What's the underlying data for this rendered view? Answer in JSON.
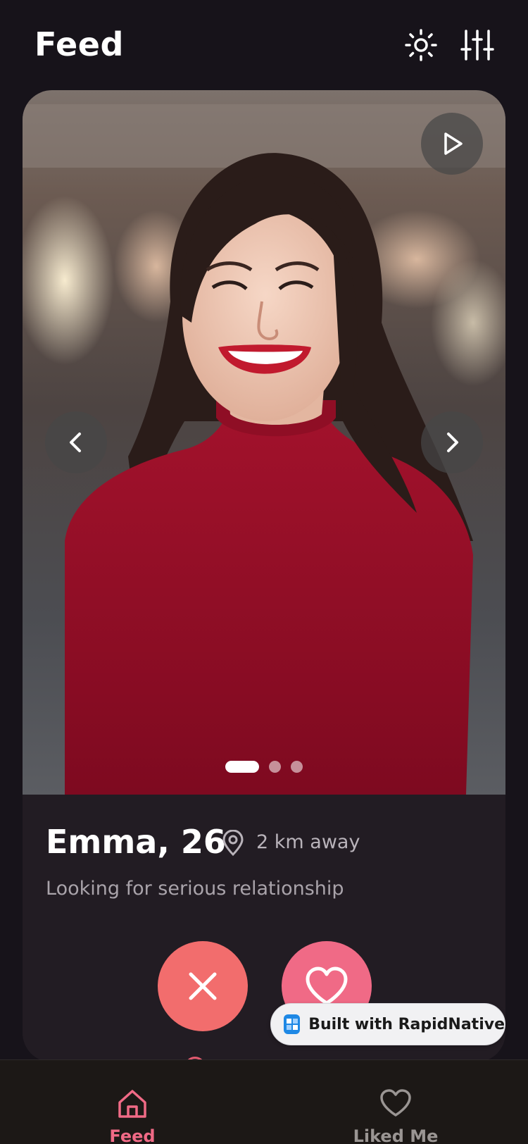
{
  "header": {
    "title": "Feed",
    "theme_icon": "sun-icon",
    "filter_icon": "sliders-icon"
  },
  "profile": {
    "name_age": "Emma, 26",
    "distance": "2 km away",
    "bio": "Looking for serious relationship",
    "photo_count": 3,
    "active_photo_index": 0,
    "photo_alt": "smiling woman with dark wavy hair in red top"
  },
  "controls": {
    "play_icon": "play-icon",
    "prev_icon": "chevron-left-icon",
    "next_icon": "chevron-right-icon",
    "dislike_icon": "close-icon",
    "like_icon": "heart-icon"
  },
  "badge": {
    "text": "Built with RapidNative"
  },
  "nav": {
    "items": [
      {
        "label": "Feed",
        "icon": "home-icon",
        "active": true
      },
      {
        "label": "Liked Me",
        "icon": "heart-outline-icon",
        "active": false
      }
    ]
  },
  "colors": {
    "background": "#17131a",
    "card": "#221c23",
    "accent": "#f06a86",
    "nope": "#f26d6d",
    "nav_background": "#1c1816"
  }
}
